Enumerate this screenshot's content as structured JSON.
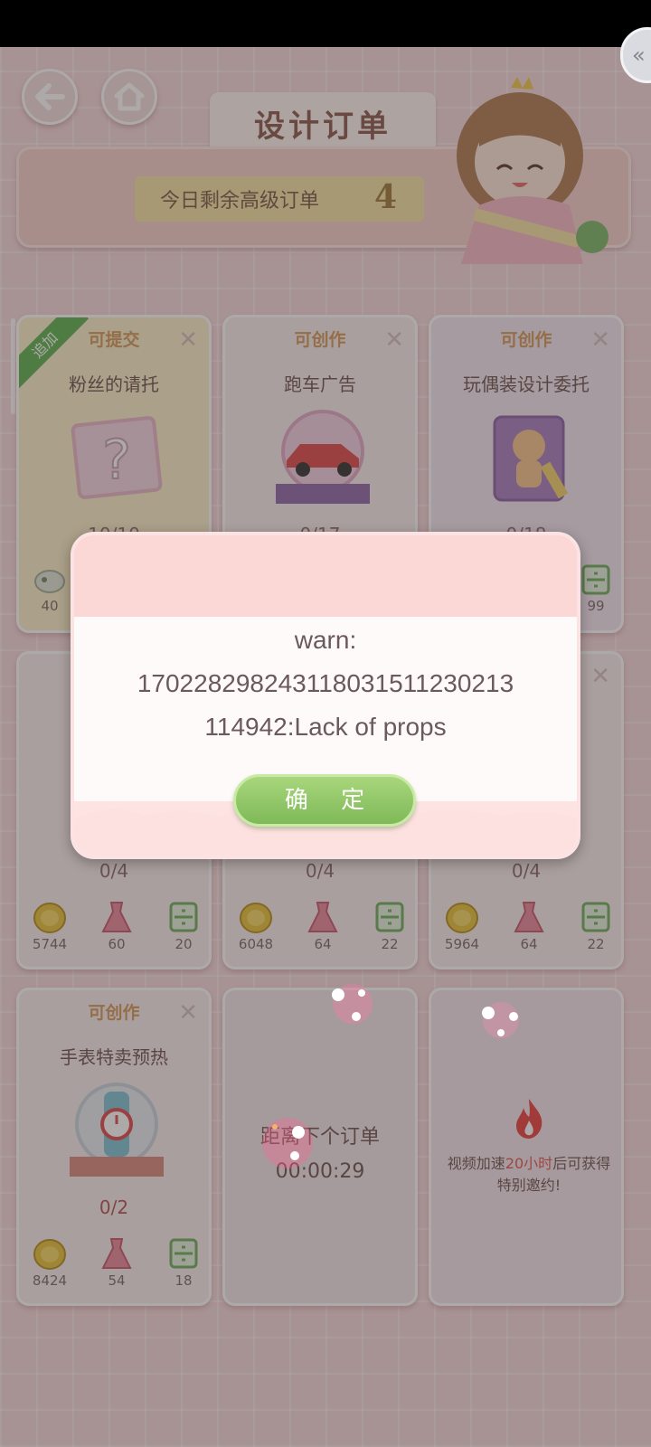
{
  "header": {
    "title": "设计订单",
    "back_icon": "arrow-left-icon",
    "home_icon": "home-icon"
  },
  "banner": {
    "label": "今日剩余高级订单",
    "count": "4"
  },
  "cards": [
    {
      "status": "可提交",
      "title": "粉丝的请托",
      "progress": "10/10",
      "tag": "追加",
      "rewards": [
        "40"
      ]
    },
    {
      "status": "可创作",
      "title": "跑车广告",
      "progress": "0/17",
      "rewards": []
    },
    {
      "status": "可创作",
      "title": "玩偶装设计委托",
      "progress": "0/18",
      "rewards": [
        "99"
      ]
    },
    {
      "progress": "0/4",
      "rewards": [
        "5744",
        "60",
        "20"
      ]
    },
    {
      "progress": "0/4",
      "rewards": [
        "6048",
        "64",
        "22"
      ]
    },
    {
      "progress": "0/4",
      "rewards": [
        "5964",
        "64",
        "22"
      ]
    },
    {
      "status": "可创作",
      "title": "手表特卖预热",
      "progress": "0/2",
      "rewards": [
        "8424",
        "54",
        "18"
      ]
    }
  ],
  "timer_card": {
    "label": "距离下个订单",
    "time": "00:00:29"
  },
  "bonus_card": {
    "text_before": "视频加速",
    "highlight": "20小时",
    "text_after": "后可获得",
    "line2": "特别邀约!"
  },
  "dialog": {
    "line1": "warn:",
    "line2": "17022829824311803151123021",
    "line2b": "3",
    "line3": "114942:Lack of props",
    "ok_label": "确 定"
  },
  "colors": {
    "background": "#f6d9db",
    "status_text": "#d39a59",
    "ok_button": "#8fc765",
    "tag_green": "#5cb24e"
  }
}
